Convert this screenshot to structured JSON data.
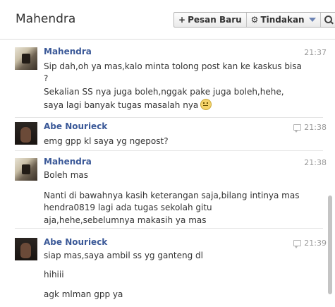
{
  "header": {
    "title": "Mahendra",
    "new_message_label": "Pesan Baru",
    "actions_label": "Tindakan"
  },
  "messages": [
    {
      "sender": "Mahendra",
      "time": "21:37",
      "lines": [
        "Sip dah,oh ya mas,kalo minta tolong post kan ke kaskus bisa",
        "?",
        "Sekalian SS nya juga boleh,nggak pake juga boleh,hehe,",
        "saya lagi banyak tugas masalah nya"
      ]
    },
    {
      "sender": "Abe Nourieck",
      "time": "21:38",
      "lines": [
        "emg gpp kl saya yg ngepost?"
      ]
    },
    {
      "sender": "Mahendra",
      "time": "21:38",
      "lines": [
        "Boleh mas",
        "Nanti di bawahnya kasih keterangan saja,bilang intinya mas",
        "hendra0819 lagi ada tugas sekolah gitu",
        "aja,hehe,sebelumnya makasih ya mas"
      ]
    },
    {
      "sender": "Abe Nourieck",
      "time": "21:39",
      "lines": [
        "siap mas,saya ambil ss yg ganteng dl",
        "hihiii",
        "agk mlman gpp ya"
      ]
    }
  ]
}
